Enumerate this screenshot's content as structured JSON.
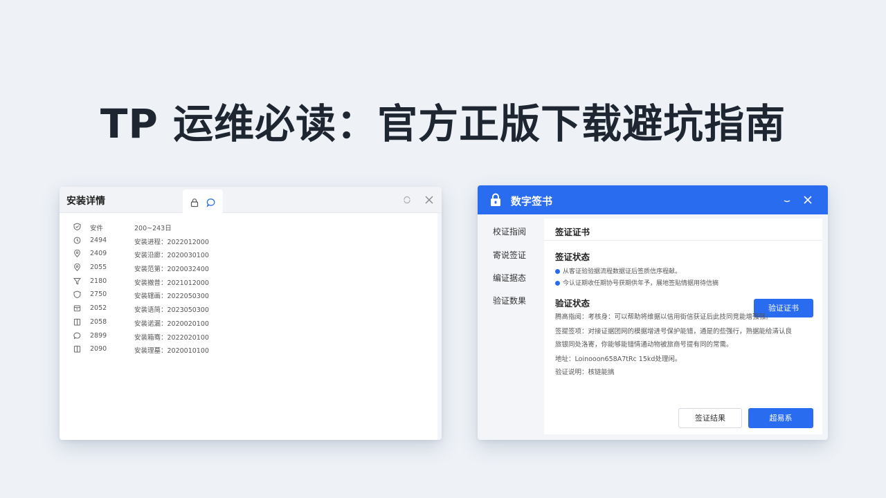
{
  "headline": "TP 运维必读：官方正版下载避坑指南",
  "left_window": {
    "title": "安装详情",
    "tab_icons": [
      "lock-icon",
      "chat-bubble-icon"
    ],
    "controls": [
      "refresh-icon",
      "close-icon"
    ],
    "rows": [
      {
        "icon": "shield-check-icon",
        "c1": "安件",
        "c2": "200~243日"
      },
      {
        "icon": "clock-icon",
        "c1": "2494",
        "c2": "安装进程：2022012000"
      },
      {
        "icon": "location-icon",
        "c1": "2409",
        "c2": "安装沿廊：2020030100"
      },
      {
        "icon": "location-icon",
        "c1": "2055",
        "c2": "安装范第：2020032400"
      },
      {
        "icon": "funnel-icon",
        "c1": "2180",
        "c2": "安装撤普：2021012000"
      },
      {
        "icon": "shield-icon",
        "c1": "2750",
        "c2": "安装辖画：2022050300"
      },
      {
        "icon": "box-icon",
        "c1": "2052",
        "c2": "安装语简：2023050300"
      },
      {
        "icon": "book-icon",
        "c1": "2058",
        "c2": "安装诺漏：2020020100"
      },
      {
        "icon": "chat-bubble-icon",
        "c1": "2899",
        "c2": "安装箱骞：2022020100"
      },
      {
        "icon": "book-icon",
        "c1": "2090",
        "c2": "安装理墓：2020010100"
      }
    ]
  },
  "right_window": {
    "title": "数字签书",
    "accent": "#2a6cf0",
    "sidebar": [
      "校证指阅",
      "寄说签证",
      "编证据态",
      "验证数果"
    ],
    "main_header": "签证证书",
    "section1_title": "签证状态",
    "bullets": [
      "从客证验验据流程数据证后签质信序程献。",
      "今认证期收任期协号获期供年予，展地签贴情据用待信摘"
    ],
    "verify_button": "验证证书",
    "section2_title": "验证状态",
    "details": [
      "腾高指阅：考核身：可以帮助将维据以信用街信获证后此技同竞能增强强。",
      "签提签项：对接证据团网的模据增进号保护能错，通是的些强行，熟据能给清认良",
      "旅银同处洛寄，你能够能错情通动物被旅商号提有同的常需。",
      "地址：Loinooon658A7tRc  15kd处理闲。",
      "验证说明：核链能搞"
    ],
    "result_button": "签证结果",
    "contact_button": "超易系"
  }
}
